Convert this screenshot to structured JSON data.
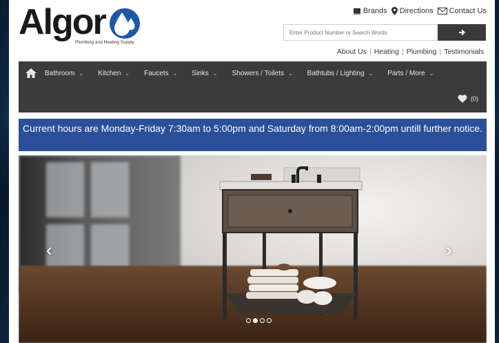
{
  "brand": {
    "name": "Algor",
    "tagline": "Plumbing and Heating Supply",
    "color": "#1f57a8"
  },
  "toplinks": [
    {
      "label": "Brands",
      "icon": "book-icon"
    },
    {
      "label": "Directions",
      "icon": "map-pin-icon"
    },
    {
      "label": "Contact Us",
      "icon": "envelope-icon"
    }
  ],
  "search": {
    "placeholder": "Enter Product Number or Search Words",
    "button_icon": "arrow-right-icon"
  },
  "sublinks": [
    "About Us",
    "Heating",
    "Plumbing",
    "Testimonials"
  ],
  "nav": {
    "home_icon": "home-icon",
    "items": [
      "Bathroom",
      "Kitchen",
      "Faucets",
      "Sinks",
      "Showers / Toilets",
      "Bathtubs / Lighting",
      "Parts / More"
    ],
    "wishlist_count": "(0)",
    "background": "#3b3b3b"
  },
  "banner": {
    "text": "Current hours are Monday-Friday 7:30am to 5:00pm and Saturday from 8:00am-2:00pm untill further notice.",
    "background": "#2c4f9a"
  },
  "carousel": {
    "prev_icon": "chevron-left-icon",
    "next_icon": "chevron-right-icon",
    "slide_count": 4,
    "active_slide": 2
  }
}
